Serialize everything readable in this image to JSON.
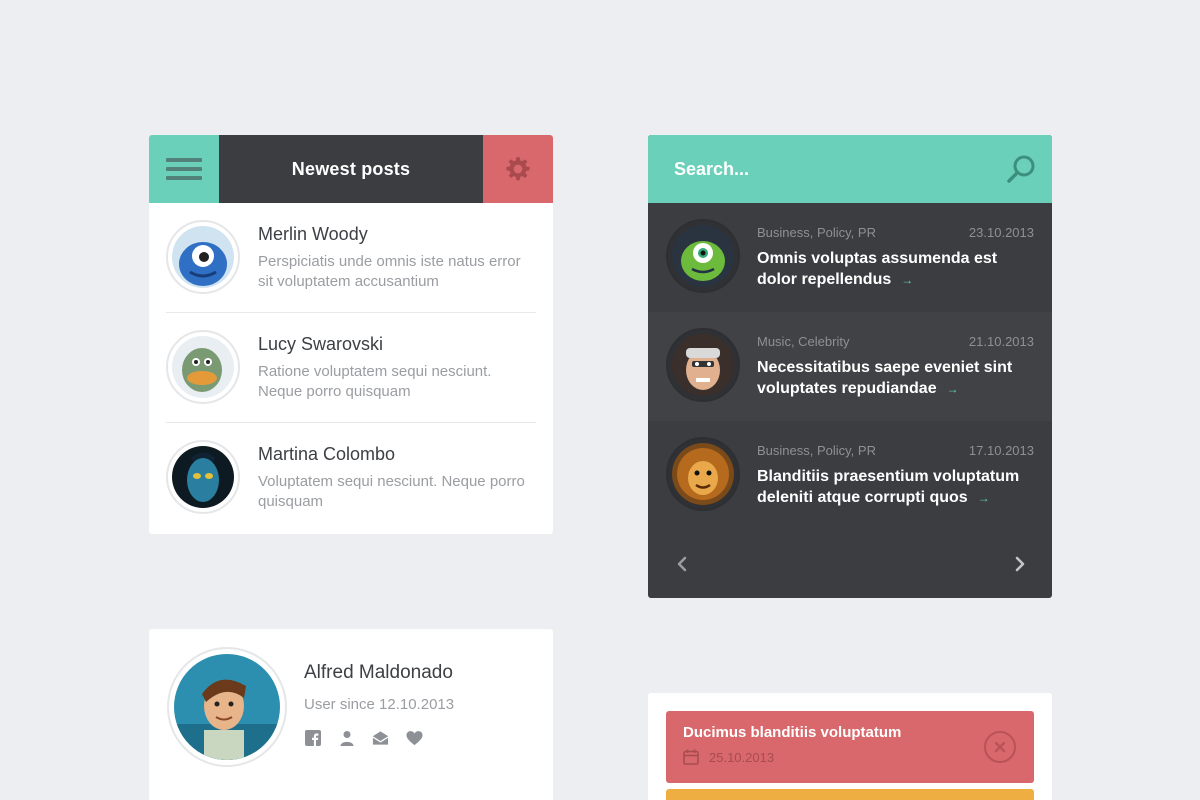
{
  "colors": {
    "background": "#eceef1",
    "accent_teal": "#6ad0b9",
    "accent_red": "#d8686b",
    "accent_orange": "#eeae42",
    "dark_panel": "#3b3d41"
  },
  "posts_widget": {
    "title": "Newest posts",
    "menu_icon": "hamburger-icon",
    "settings_icon": "gear-icon",
    "items": [
      {
        "name": "Merlin Woody",
        "text": "Perspiciatis unde omnis iste natus error sit voluptatem accusantium",
        "avatar": "blue-alien-avatar"
      },
      {
        "name": "Lucy Swarovski",
        "text": "Ratione voluptatem sequi nesciunt. Neque porro quisquam",
        "avatar": "green-monster-avatar"
      },
      {
        "name": "Martina Colombo",
        "text": "Voluptatem sequi nesciunt. Neque porro quisquam",
        "avatar": "blue-navi-avatar"
      }
    ]
  },
  "feed_widget": {
    "search_placeholder": "Search...",
    "search_icon": "search-icon",
    "items": [
      {
        "tags": "Business, Policy, PR",
        "date": "23.10.2013",
        "title": "Omnis voluptas assumenda est dolor repellendus",
        "arrow": "→",
        "avatar": "green-cyclops-avatar"
      },
      {
        "tags": "Music, Celebrity",
        "date": "21.10.2013",
        "title": "Necessitatibus saepe eveniet sint voluptates repudiandae",
        "arrow": "→",
        "avatar": "old-man-avatar"
      },
      {
        "tags": "Business, Policy, PR",
        "date": "17.10.2013",
        "title": "Blanditiis praesentium voluptatum deleniti atque corrupti quos",
        "arrow": "→",
        "avatar": "lion-avatar"
      }
    ],
    "prev_icon": "chevron-left-icon",
    "next_icon": "chevron-right-icon"
  },
  "profile_widget": {
    "name": "Alfred Maldonado",
    "since": "User since 12.10.2013",
    "icons": [
      "facebook-icon",
      "user-icon",
      "mail-icon",
      "heart-icon"
    ],
    "avatar": "cartoon-hero-avatar"
  },
  "notifications_widget": {
    "items": [
      {
        "title": "Ducimus blanditiis voluptatum",
        "date": "25.10.2013",
        "icon": "calendar-icon",
        "close_icon": "close-icon"
      }
    ]
  }
}
